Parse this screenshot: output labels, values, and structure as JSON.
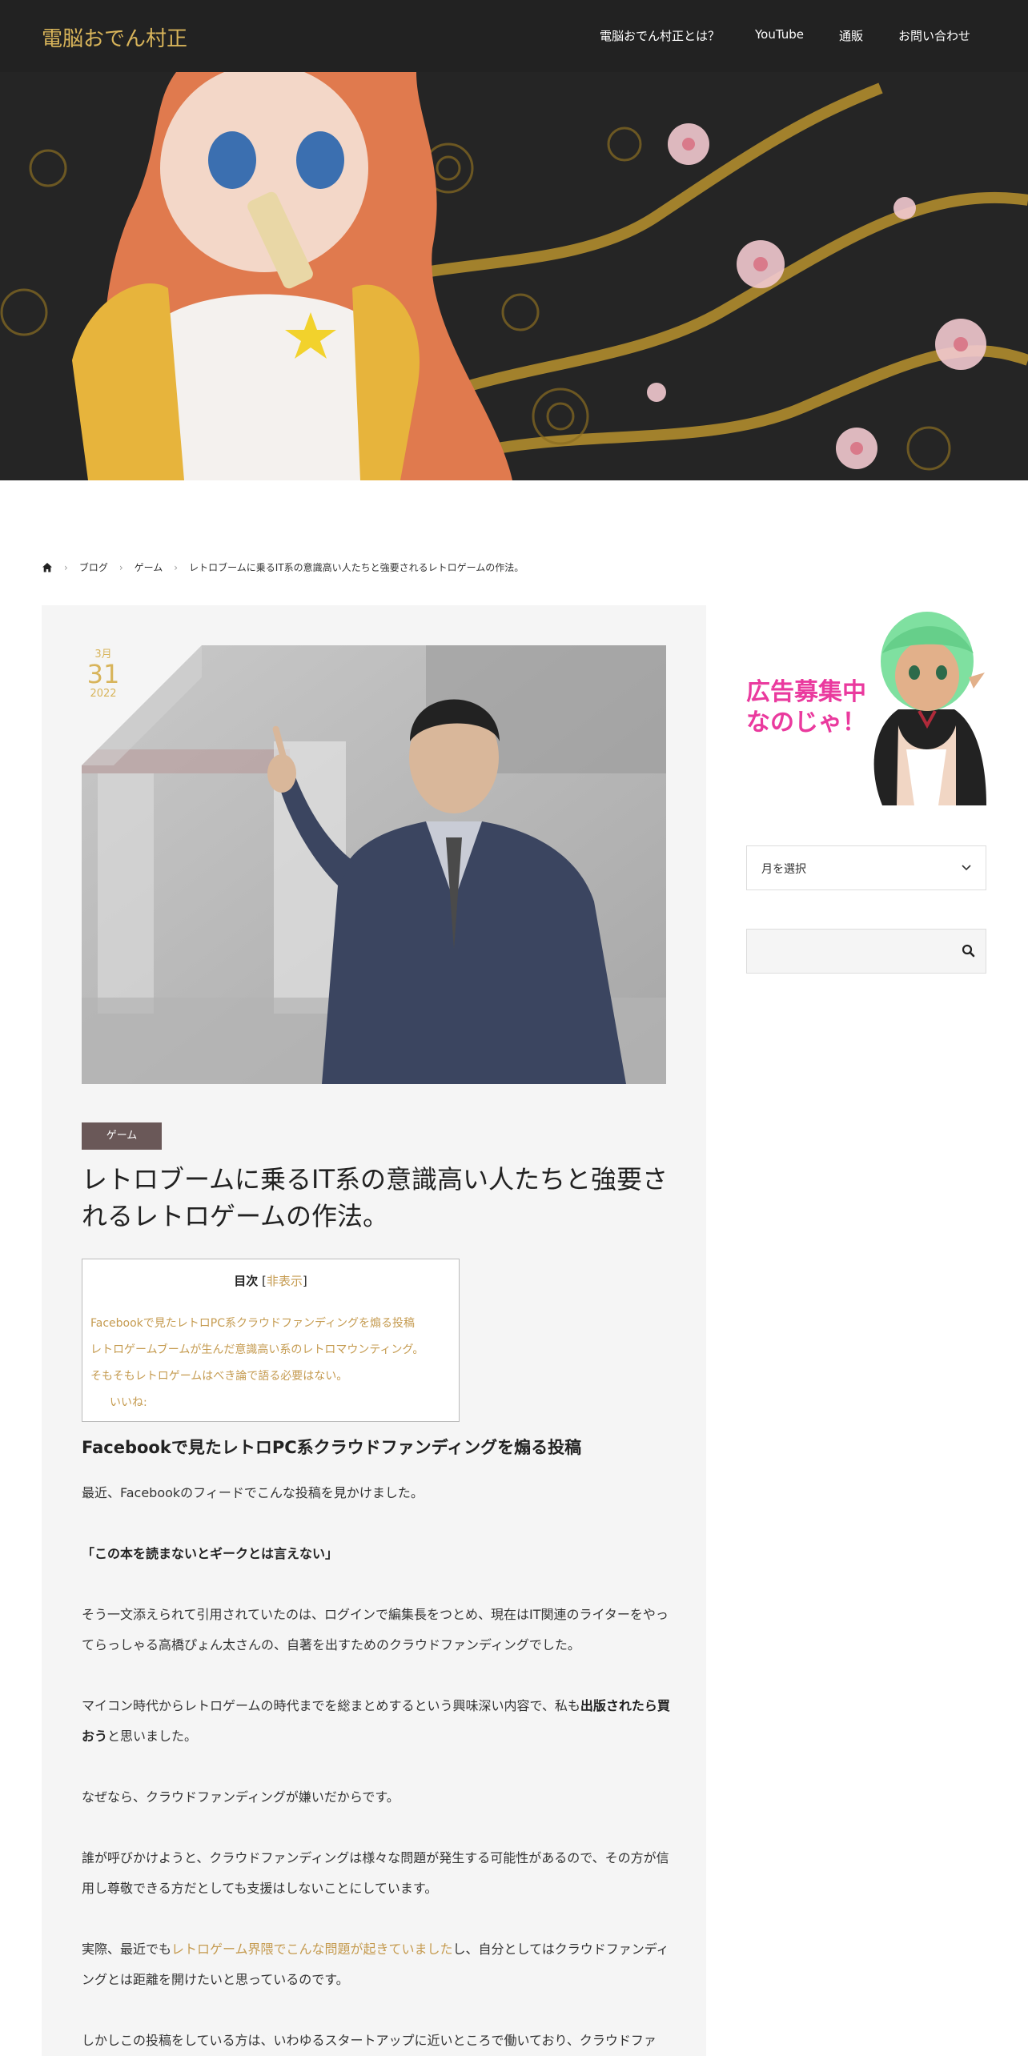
{
  "header": {
    "site_title": "電脳おでん村正",
    "nav": [
      "電脳おでん村正とは？",
      "YouTube",
      "通販",
      "お問い合わせ"
    ]
  },
  "breadcrumb": {
    "items": [
      "ブログ",
      "ゲーム",
      "レトロブームに乗るIT系の意識高い人たちと強要されるレトロゲームの作法。"
    ]
  },
  "post": {
    "date": {
      "month": "3月",
      "day": "31",
      "year": "2022"
    },
    "category": "ゲーム",
    "title": "レトロブームに乗るIT系の意識高い人たちと強要されるレトロゲームの作法。",
    "toc": {
      "title": "目次",
      "toggle_open": "[",
      "toggle": "非表示",
      "toggle_close": "]",
      "items": [
        "Facebookで見たレトロPC系クラウドファンディングを煽る投稿",
        "レトロゲームブームが生んだ意識高い系のレトロマウンティング。",
        "そもそもレトロゲームはべき論で語る必要はない。",
        "いいね:"
      ]
    },
    "heading": "Facebookで見たレトロPC系クラウドファンディングを煽る投稿",
    "paragraphs": {
      "p1": "最近、Facebookのフィードでこんな投稿を見かけました。",
      "p2": "「この本を読まないとギークとは言えない」",
      "p3": "そう一文添えられて引用されていたのは、ログインで編集長をつとめ、現在はIT関連のライターをやってらっしゃる高橋ぴょん太さんの、自著を出すためのクラウドファンディングでした。",
      "p4_a": "マイコン時代からレトロゲームの時代までを総まとめするという興味深い内容で、私も",
      "p4_b": "出版されたら買おう",
      "p4_c": "と思いました。",
      "p5": "なぜなら、クラウドファンディングが嫌いだからです。",
      "p6": "誰が呼びかけようと、クラウドファンディングは様々な問題が発生する可能性があるので、その方が信用し尊敬できる方だとしても支援はしないことにしています。",
      "p7_a": "実際、最近でも",
      "p7_link": "レトロゲーム界隈でこんな問題が起きていました",
      "p7_b": "し、自分としてはクラウドファンディングとは距離を開けたいと思っているのです。",
      "p8": "しかしこの投稿をしている方は、いわゆるスタートアップに近いところで働いており、クラウドファ"
    }
  },
  "sidebar": {
    "ad_text_line1": "広告募集中",
    "ad_text_line2": "なのじゃ！",
    "archive_select": "月を選択",
    "search_placeholder": ""
  },
  "colors": {
    "header_bg": "#222222",
    "accent_gold": "#d8b45a",
    "link": "#c59b50",
    "category_badge": "#6a5858",
    "ad_pink": "#ea3a9e"
  }
}
